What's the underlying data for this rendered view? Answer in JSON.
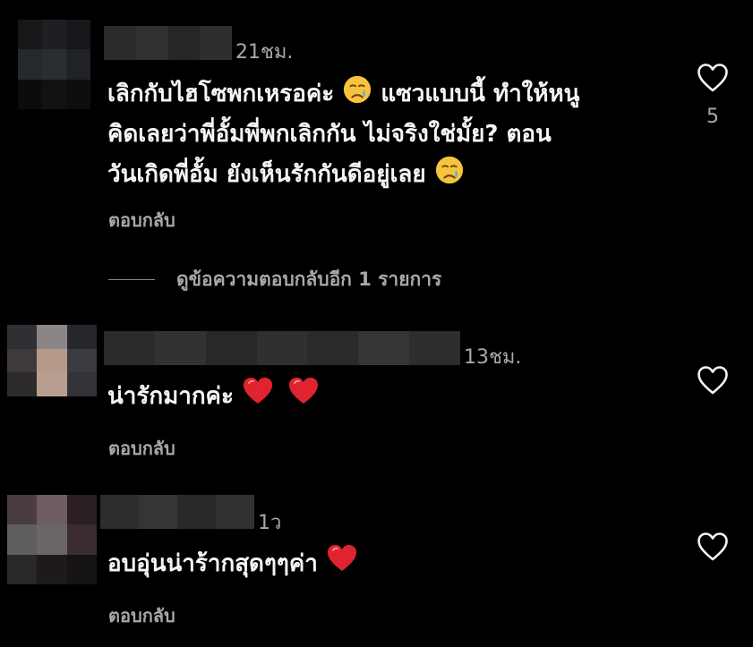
{
  "comments": [
    {
      "time": "21ชม.",
      "text_line1": "เลิกกับไฮโซพกเหรอค่ะ",
      "text_line1b": "แซวแบบนี้ ทำให้หนู",
      "text_line2": "คิดเลยว่าพี่อั้มพี่พกเลิกกัน ไม่จริงใช่มั้ย? ตอน",
      "text_line3": "วันเกิดพี่อั้ม ยังเห็นรักกันดีอยู่เลย",
      "reply_label": "ตอบกลับ",
      "likes": "5",
      "view_replies": "ดูข้อความตอบกลับอีก 1 รายการ"
    },
    {
      "time": "13ชม.",
      "text": "น่ารักมากค่ะ",
      "reply_label": "ตอบกลับ"
    },
    {
      "time": "1ว",
      "text": "อบอุ่นน่าร้ากสุดๆๆค่า",
      "reply_label": "ตอบกลับ"
    }
  ],
  "icons": {
    "like": "heart-outline-icon",
    "crying": "crying-face-emoji",
    "red_heart": "red-heart-emoji"
  },
  "colors": {
    "background": "#000000",
    "text": "#f5f5f5",
    "secondary": "#a8a8a8",
    "heart_red": "#e0242f",
    "emoji_yellow": "#f7c33b"
  }
}
